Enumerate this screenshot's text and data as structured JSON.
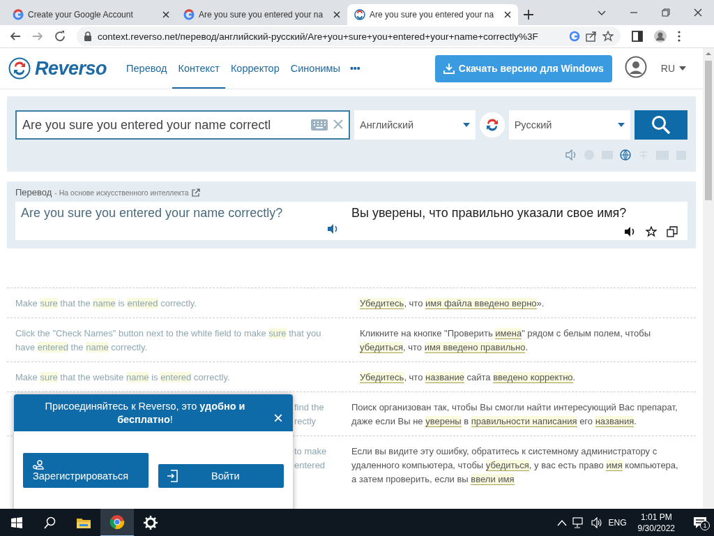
{
  "browser": {
    "tabs": [
      {
        "title": "Create your Google Account",
        "kind": "google",
        "selected": false
      },
      {
        "title": "Are you sure you entered your na",
        "kind": "google",
        "selected": false
      },
      {
        "title": "Are you sure you entered your na",
        "kind": "reverso",
        "selected": true
      }
    ],
    "url": "context.reverso.net/перевод/английский-русский/Are+you+sure+you+entered+your+name+correctly%3F"
  },
  "header": {
    "logo": "Reverso",
    "nav": [
      {
        "label": "Перевод",
        "selected": false
      },
      {
        "label": "Контекст",
        "selected": true
      },
      {
        "label": "Корректор",
        "selected": false
      },
      {
        "label": "Синонимы",
        "selected": false
      }
    ],
    "more": "•••",
    "download": "Скачать версию для Windows",
    "language": "RU"
  },
  "search": {
    "value": "Are you sure you entered your name correctl",
    "source_language": "Английский",
    "target_language": "Русский"
  },
  "translation": {
    "label": "Перевод",
    "note": "- На основе искусственного интеллекта",
    "source": "Are you sure you entered your name correctly?",
    "target": "Вы уверены, что правильно указали свое имя?"
  },
  "examples": [
    {
      "en": "Make **sure** that the **name** is **entered** correctly.",
      "ru": "**Убедитесь**, что **имя файла введено верно**»."
    },
    {
      "en": "Click the \"Check Names\" button next to the white field to make **sure** that you have **entered** the **name** correctly.",
      "ru": "Кликните на кнопке \"Проверить **имена**\" рядом с белым полем, чтобы **убедиться**, что **имя введено правильно**."
    },
    {
      "en": "Make **sure** that the website **name** is **entered** correctly.",
      "ru": "**Убедитесь**, что **название** сайта **введено корректно**."
    },
    {
      "en_visible": [
        "find the",
        "rectly"
      ],
      "ru": "Поиск организован так, чтобы Вы смогли найти интересующий Вас препарат, даже если Вы не **уверены** в **правильности написания** его **названия**."
    },
    {
      "en_visible": [
        "to make",
        "entered"
      ],
      "ru": "Если вы видите эту ошибку, обратитесь к системному администратору с удаленного компьютера, чтобы **убедиться**, у вас есть право **имя** компьютера, а затем проверить, если вы **ввели имя**"
    }
  ],
  "popup": {
    "title": "Присоединяйтесь к Reverso, это **удобно и бесплатно**!",
    "close": "×",
    "register": "Зарегистрироваться",
    "login": "Войти"
  },
  "taskbar": {
    "language": "ENG",
    "time": "1:01 PM",
    "date": "9/30/2022",
    "notifications": "1"
  }
}
